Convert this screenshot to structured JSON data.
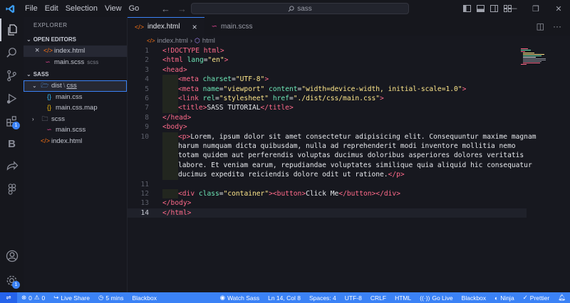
{
  "titlebar": {
    "menu": [
      "File",
      "Edit",
      "Selection",
      "View",
      "Go"
    ],
    "search_text": "sass",
    "window_controls": [
      "minimize",
      "restore",
      "close"
    ]
  },
  "activitybar": {
    "items": [
      {
        "name": "explorer",
        "active": true
      },
      {
        "name": "search"
      },
      {
        "name": "source-control"
      },
      {
        "name": "run-debug"
      },
      {
        "name": "extensions",
        "badge": "1"
      },
      {
        "name": "bootstrap",
        "glyph": "B"
      },
      {
        "name": "live-share"
      },
      {
        "name": "figma"
      }
    ],
    "bottom": [
      {
        "name": "accounts"
      },
      {
        "name": "manage",
        "badge": "1"
      }
    ]
  },
  "sidebar": {
    "title": "EXPLORER",
    "open_editors_label": "OPEN EDITORS",
    "open_editors": [
      {
        "name": "index.html",
        "type": "html",
        "close": "×",
        "selected": true
      },
      {
        "name": "main.scss",
        "type": "scss",
        "folder": "scss"
      }
    ],
    "project_label": "SASS",
    "tree": [
      {
        "name_a": "dist",
        "name_b": "css",
        "type": "folder-open",
        "depth": 1,
        "selected": true
      },
      {
        "name": "main.css",
        "type": "css",
        "depth": 2
      },
      {
        "name": "main.css.map",
        "type": "json",
        "depth": 2
      },
      {
        "name": "scss",
        "type": "folder",
        "depth": 1
      },
      {
        "name": "main.scss",
        "type": "scss",
        "depth": 2
      },
      {
        "name": "index.html",
        "type": "html",
        "depth": 1
      }
    ]
  },
  "tabs": [
    {
      "label": "index.html",
      "type": "html",
      "active": true,
      "close": "×"
    },
    {
      "label": "main.scss",
      "type": "scss",
      "active": false
    }
  ],
  "breadcrumb": {
    "file": "index.html",
    "separator": "›",
    "element": "html"
  },
  "editor": {
    "current_line": 14,
    "lines": [
      {
        "n": "1",
        "indent": 0,
        "parts": [
          [
            "doc",
            "<!DOCTYPE "
          ],
          [
            "tag",
            "html"
          ],
          [
            "doc",
            ">"
          ]
        ]
      },
      {
        "n": "2",
        "indent": 0,
        "parts": [
          [
            "tag",
            "<html "
          ],
          [
            "attr",
            "lang"
          ],
          [
            "txt",
            "="
          ],
          [
            "str",
            "\"en\""
          ],
          [
            "tag",
            ">"
          ]
        ]
      },
      {
        "n": "3",
        "indent": 0,
        "parts": [
          [
            "tag",
            "<head>"
          ]
        ]
      },
      {
        "n": "4",
        "indent": 1,
        "parts": [
          [
            "tag",
            "<meta "
          ],
          [
            "attr",
            "charset"
          ],
          [
            "txt",
            "="
          ],
          [
            "str",
            "\"UTF-8\""
          ],
          [
            "tag",
            ">"
          ]
        ]
      },
      {
        "n": "5",
        "indent": 1,
        "parts": [
          [
            "tag",
            "<meta "
          ],
          [
            "attr",
            "name"
          ],
          [
            "txt",
            "="
          ],
          [
            "str",
            "\"viewport\" "
          ],
          [
            "attr",
            "content"
          ],
          [
            "txt",
            "="
          ],
          [
            "str",
            "\"width=device-width, initial-scale=1.0\""
          ],
          [
            "tag",
            ">"
          ]
        ]
      },
      {
        "n": "6",
        "indent": 1,
        "parts": [
          [
            "tag",
            "<link "
          ],
          [
            "attr",
            "rel"
          ],
          [
            "txt",
            "="
          ],
          [
            "str",
            "\"stylesheet\" "
          ],
          [
            "attr",
            "href"
          ],
          [
            "txt",
            "="
          ],
          [
            "str",
            "\"./dist/css/main.css\""
          ],
          [
            "tag",
            ">"
          ]
        ]
      },
      {
        "n": "7",
        "indent": 1,
        "parts": [
          [
            "tag",
            "<title>"
          ],
          [
            "txt",
            "SASS TUTORIAL"
          ],
          [
            "tag",
            "</title>"
          ]
        ]
      },
      {
        "n": "8",
        "indent": 0,
        "parts": [
          [
            "tag",
            "</head>"
          ]
        ]
      },
      {
        "n": "9",
        "indent": 0,
        "parts": [
          [
            "tag",
            "<body>"
          ]
        ]
      },
      {
        "n": "10",
        "indent": 1,
        "parts": [
          [
            "tag",
            "<p>"
          ],
          [
            "txt",
            "Lorem, ipsum dolor sit amet consectetur adipisicing elit. Consequuntur maxime magnam"
          ]
        ]
      },
      {
        "n": "",
        "indent": 1,
        "plain": true,
        "parts": [
          [
            "txt",
            "harum numquam dicta quibusdam, nulla ad reprehenderit modi inventore mollitia nemo"
          ]
        ]
      },
      {
        "n": "",
        "indent": 1,
        "plain": true,
        "parts": [
          [
            "txt",
            "totam quidem aut perferendis voluptas ducimus doloribus asperiores dolores veritatis"
          ]
        ]
      },
      {
        "n": "",
        "indent": 1,
        "plain": true,
        "parts": [
          [
            "txt",
            "labore. Et veniam earum, repudiandae voluptates similique quia aliquid hic consequatur"
          ]
        ]
      },
      {
        "n": "",
        "indent": 1,
        "plain": true,
        "parts": [
          [
            "txt",
            "ducimus expedita reiciendis dolore odit ut ratione."
          ],
          [
            "tag",
            "</p>"
          ]
        ]
      },
      {
        "n": "11",
        "indent": 0,
        "parts": []
      },
      {
        "n": "12",
        "indent": 1,
        "parts": [
          [
            "tag",
            "<div "
          ],
          [
            "attr",
            "class"
          ],
          [
            "txt",
            "="
          ],
          [
            "str",
            "\"container\""
          ],
          [
            "tag",
            ">"
          ],
          [
            "tag",
            "<button>"
          ],
          [
            "txt",
            "Click Me"
          ],
          [
            "tag",
            "</button>"
          ],
          [
            "tag",
            "</div>"
          ]
        ]
      },
      {
        "n": "13",
        "indent": 0,
        "parts": [
          [
            "tag",
            "</body>"
          ]
        ]
      },
      {
        "n": "14",
        "indent": 0,
        "parts": [
          [
            "tag",
            "</html>"
          ]
        ]
      }
    ]
  },
  "statusbar": {
    "errors": "0",
    "warnings": "0",
    "live_share": "Live Share",
    "time": "5 mins",
    "blackbox_left": "Blackbox",
    "watch_sass": "Watch Sass",
    "position": "Ln 14, Col 8",
    "spaces": "Spaces: 4",
    "encoding": "UTF-8",
    "eol": "CRLF",
    "language": "HTML",
    "go_live": "Go Live",
    "blackbox_right": "Blackbox",
    "ninja": "Ninja",
    "prettier": "Prettier"
  },
  "colors": {
    "background": "#17181f",
    "accent": "#3b82f6",
    "tag": "#ff6a8a",
    "attr": "#6ee7b7",
    "string": "#fde68a"
  }
}
